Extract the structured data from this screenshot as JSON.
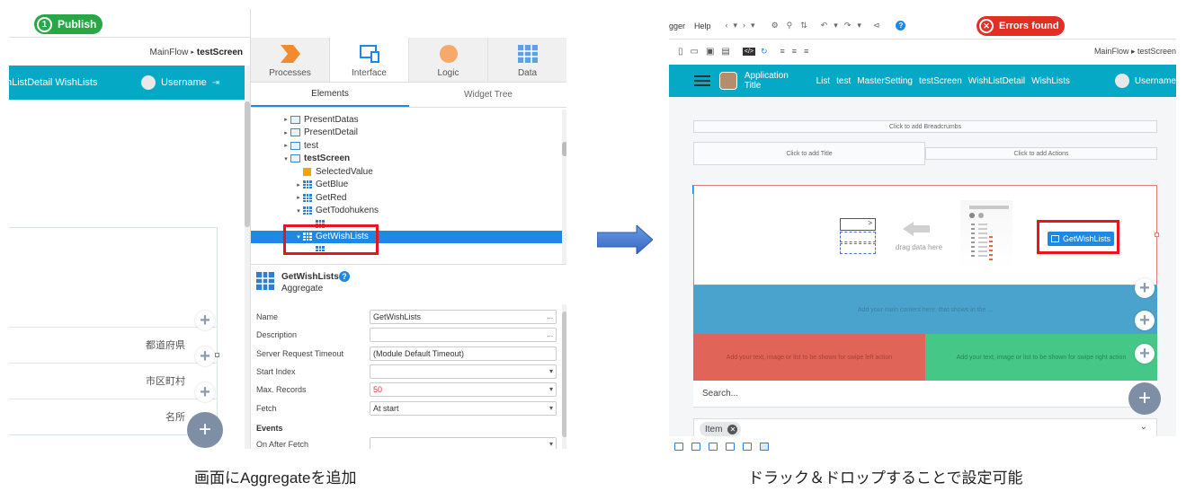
{
  "left": {
    "publish": {
      "number": "1",
      "label": "Publish"
    },
    "breadcrumb": {
      "flow": "MainFlow",
      "screen": "testScreen"
    },
    "header": {
      "links": "hListDetail  WishLists",
      "username": "Username"
    },
    "form_fields": [
      "都道府県",
      "市区町村",
      "名所"
    ],
    "tabs": [
      "Processes",
      "Interface",
      "Logic",
      "Data"
    ],
    "subtabs": [
      "Elements",
      "Widget Tree"
    ],
    "tree": [
      {
        "label": "PresentDatas",
        "icon": "screen-icon",
        "caret": "▸",
        "indent": 0
      },
      {
        "label": "PresentDetail",
        "icon": "screen-icon",
        "caret": "▸",
        "indent": 0
      },
      {
        "label": "test",
        "icon": "screen-icon",
        "caret": "▸",
        "indent": 0
      },
      {
        "label": "testScreen",
        "icon": "screen-icon",
        "caret": "▾",
        "indent": 0,
        "bold": true
      },
      {
        "label": "SelectedValue",
        "icon": "variable-icon",
        "caret": "",
        "indent": 1
      },
      {
        "label": "GetBlue",
        "icon": "aggregate-icon",
        "caret": "▸",
        "indent": 1
      },
      {
        "label": "GetRed",
        "icon": "aggregate-icon",
        "caret": "▸",
        "indent": 1
      },
      {
        "label": "GetTodohukens",
        "icon": "aggregate-icon",
        "caret": "▾",
        "indent": 1
      },
      {
        "label": "",
        "icon": "aggregate-icon",
        "caret": "",
        "indent": 2
      },
      {
        "label": "GetWishLists",
        "icon": "aggregate-icon",
        "caret": "▾",
        "indent": 1,
        "selected": true
      },
      {
        "label": "",
        "icon": "aggregate-icon",
        "caret": "",
        "indent": 2
      }
    ],
    "props_title": "GetWishLists",
    "props_subtitle": "Aggregate",
    "props": [
      {
        "label": "Name",
        "value": "GetWishLists",
        "suffix": "..."
      },
      {
        "label": "Description",
        "value": "",
        "suffix": "..."
      },
      {
        "label": "Server Request Timeout",
        "value": "(Module Default Timeout)",
        "suffix": ""
      },
      {
        "label": "Start Index",
        "value": "",
        "suffix": "▾"
      },
      {
        "label": "Max. Records",
        "value": "50",
        "suffix": "▾",
        "value_color": "#e53935"
      },
      {
        "label": "Fetch",
        "value": "At start",
        "suffix": "▾"
      }
    ],
    "events_label": "Events",
    "event_prop": {
      "label": "On After Fetch",
      "value": "",
      "suffix": "▾"
    }
  },
  "right": {
    "menu": [
      "gger",
      "Help"
    ],
    "errors_label": "Errors found",
    "breadcrumb": "MainFlow ▸ testScreen",
    "header": {
      "title": "Application Title",
      "links": [
        "List",
        "test",
        "MasterSetting",
        "testScreen",
        "WishListDetail",
        "WishLists"
      ],
      "username": "Username"
    },
    "placeholders": {
      "breadcrumbs": "Click to add Breadcrumbs",
      "title": "Click to add Title",
      "actions": "Click to add Actions"
    },
    "drag_hint": "drag data here",
    "chip_label": "GetWishLists",
    "band_blue": "Add your main content here, that shows in the ...",
    "band_red": "Add your text, image or list to be shown for swipe left action",
    "band_green": "Add your text, image or list to be shown for swipe right action",
    "search": "Search...",
    "item_chip": "Item"
  },
  "captions": {
    "left": "画面にAggregateを追加",
    "right": "ドラック＆ドロップすることで設定可能"
  },
  "colors": {
    "teal": "#05a9c6",
    "publish_green": "#27a745",
    "error_red": "#e32e26",
    "highlight": "#e8141e",
    "select_blue": "#1e88e5"
  }
}
